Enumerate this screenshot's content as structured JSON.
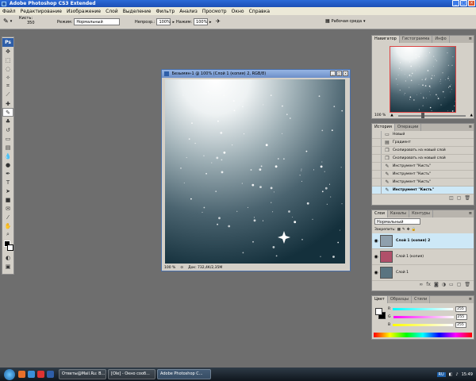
{
  "window": {
    "title": "Adobe Photoshop CS3 Extended"
  },
  "menu": [
    "Файл",
    "Редактирование",
    "Изображение",
    "Слой",
    "Выделение",
    "Фильтр",
    "Анализ",
    "Просмотр",
    "Окно",
    "Справка"
  ],
  "options": {
    "brush_label": "Кисть:",
    "brush_size": "350",
    "mode_label": "Режим:",
    "mode_value": "Нормальный",
    "opacity_label": "Непрозр.:",
    "opacity_value": "100%",
    "flow_label": "Нажим:",
    "flow_value": "100%",
    "workspace_label": "Рабочая среда"
  },
  "document": {
    "title": "Безымян-1 @ 100% (Слой 1 (копия) 2, RGB/8)",
    "zoom": "100 %",
    "docsize": "Док: 732,4K/2,35M"
  },
  "navigator": {
    "tabs": [
      "Навигатор",
      "Гистограмма",
      "Инфо"
    ],
    "zoom": "100 %"
  },
  "history": {
    "tabs": [
      "История",
      "Операции"
    ],
    "items": [
      {
        "label": "Новый",
        "icon": "document-icon",
        "selected": false
      },
      {
        "label": "Градиент",
        "icon": "gradient-icon",
        "selected": false
      },
      {
        "label": "Скопировать на новый слой",
        "icon": "copy-layer-icon",
        "selected": false
      },
      {
        "label": "Скопировать на новый слой",
        "icon": "copy-layer-icon",
        "selected": false
      },
      {
        "label": "Инструмент \"Кисть\"",
        "icon": "brush-icon",
        "selected": false
      },
      {
        "label": "Инструмент \"Кисть\"",
        "icon": "brush-icon",
        "selected": false
      },
      {
        "label": "Инструмент \"Кисть\"",
        "icon": "brush-icon",
        "selected": false
      },
      {
        "label": "Инструмент \"Кисть\"",
        "icon": "brush-icon",
        "selected": true
      }
    ]
  },
  "layers": {
    "tabs": [
      "Слои",
      "Каналы",
      "Контуры"
    ],
    "blend_mode": "Нормальный",
    "lock_label": "Закрепить:",
    "items": [
      {
        "name": "Слой 1 (копия) 2",
        "selected": true,
        "thumb": "#8fa0ad"
      },
      {
        "name": "Слой 1 (копия)",
        "selected": false,
        "thumb": "#b0506a"
      },
      {
        "name": "Слой 1",
        "selected": false,
        "thumb": "#5a7480"
      }
    ]
  },
  "color": {
    "tabs": [
      "Цвет",
      "Образцы",
      "Стили"
    ],
    "channels": [
      {
        "label": "R",
        "value": "255",
        "gradient": "linear-gradient(90deg,#0ff,#fff)"
      },
      {
        "label": "G",
        "value": "255",
        "gradient": "linear-gradient(90deg,#f0f,#fff)"
      },
      {
        "label": "B",
        "value": "255",
        "gradient": "linear-gradient(90deg,#ff0,#fff)"
      }
    ]
  },
  "taskbar": {
    "tasks": [
      {
        "label": "Ответы@Mail.Ru: В...",
        "active": false
      },
      {
        "label": "[Ole] - Окно сооб...",
        "active": false
      },
      {
        "label": "Adobe Photoshop C...",
        "active": true
      }
    ],
    "lang": "RU",
    "clock": "15:49"
  },
  "toolbox": {
    "logo": "Ps"
  }
}
